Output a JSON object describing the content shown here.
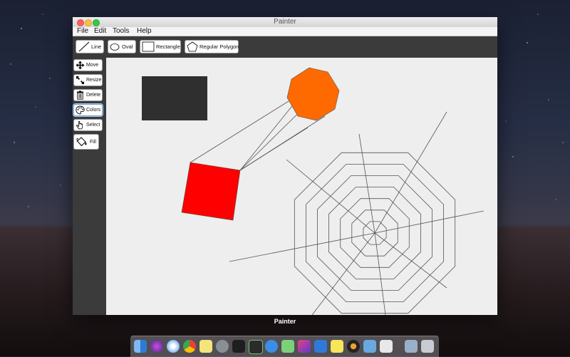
{
  "window": {
    "title": "Painter"
  },
  "menu": [
    "File",
    "Edit",
    "Tools",
    "Help"
  ],
  "toolbar": {
    "line_label": "Line",
    "oval_label": "Oval",
    "rectangle_label": "Rectangle",
    "polygon_label": "Regular Polygon"
  },
  "sidebar": {
    "move_label": "Move",
    "resize_label": "Resize",
    "delete_label": "Delete",
    "colors_label": "Colors",
    "select_label": "Select",
    "fill_label": "Fill"
  },
  "canvas": {
    "colors": {
      "dark_rect": "#2f2f2f",
      "red_square": "#ff0000",
      "octagon": "#ff6a00",
      "lines": "#555555"
    }
  },
  "dock_caption": "Painter",
  "dock_icons": [
    "finder-icon",
    "siri-icon",
    "safari-icon",
    "chrome-icon",
    "notes-icon",
    "system-preferences-icon",
    "terminal-icon",
    "activity-monitor-icon",
    "xcode-icon",
    "android-studio-icon",
    "intellij-icon",
    "visual-studio-code-icon",
    "stickies-icon",
    "music-icon",
    "preview-icon",
    "java-icon",
    "downloads-icon",
    "trash-icon"
  ]
}
